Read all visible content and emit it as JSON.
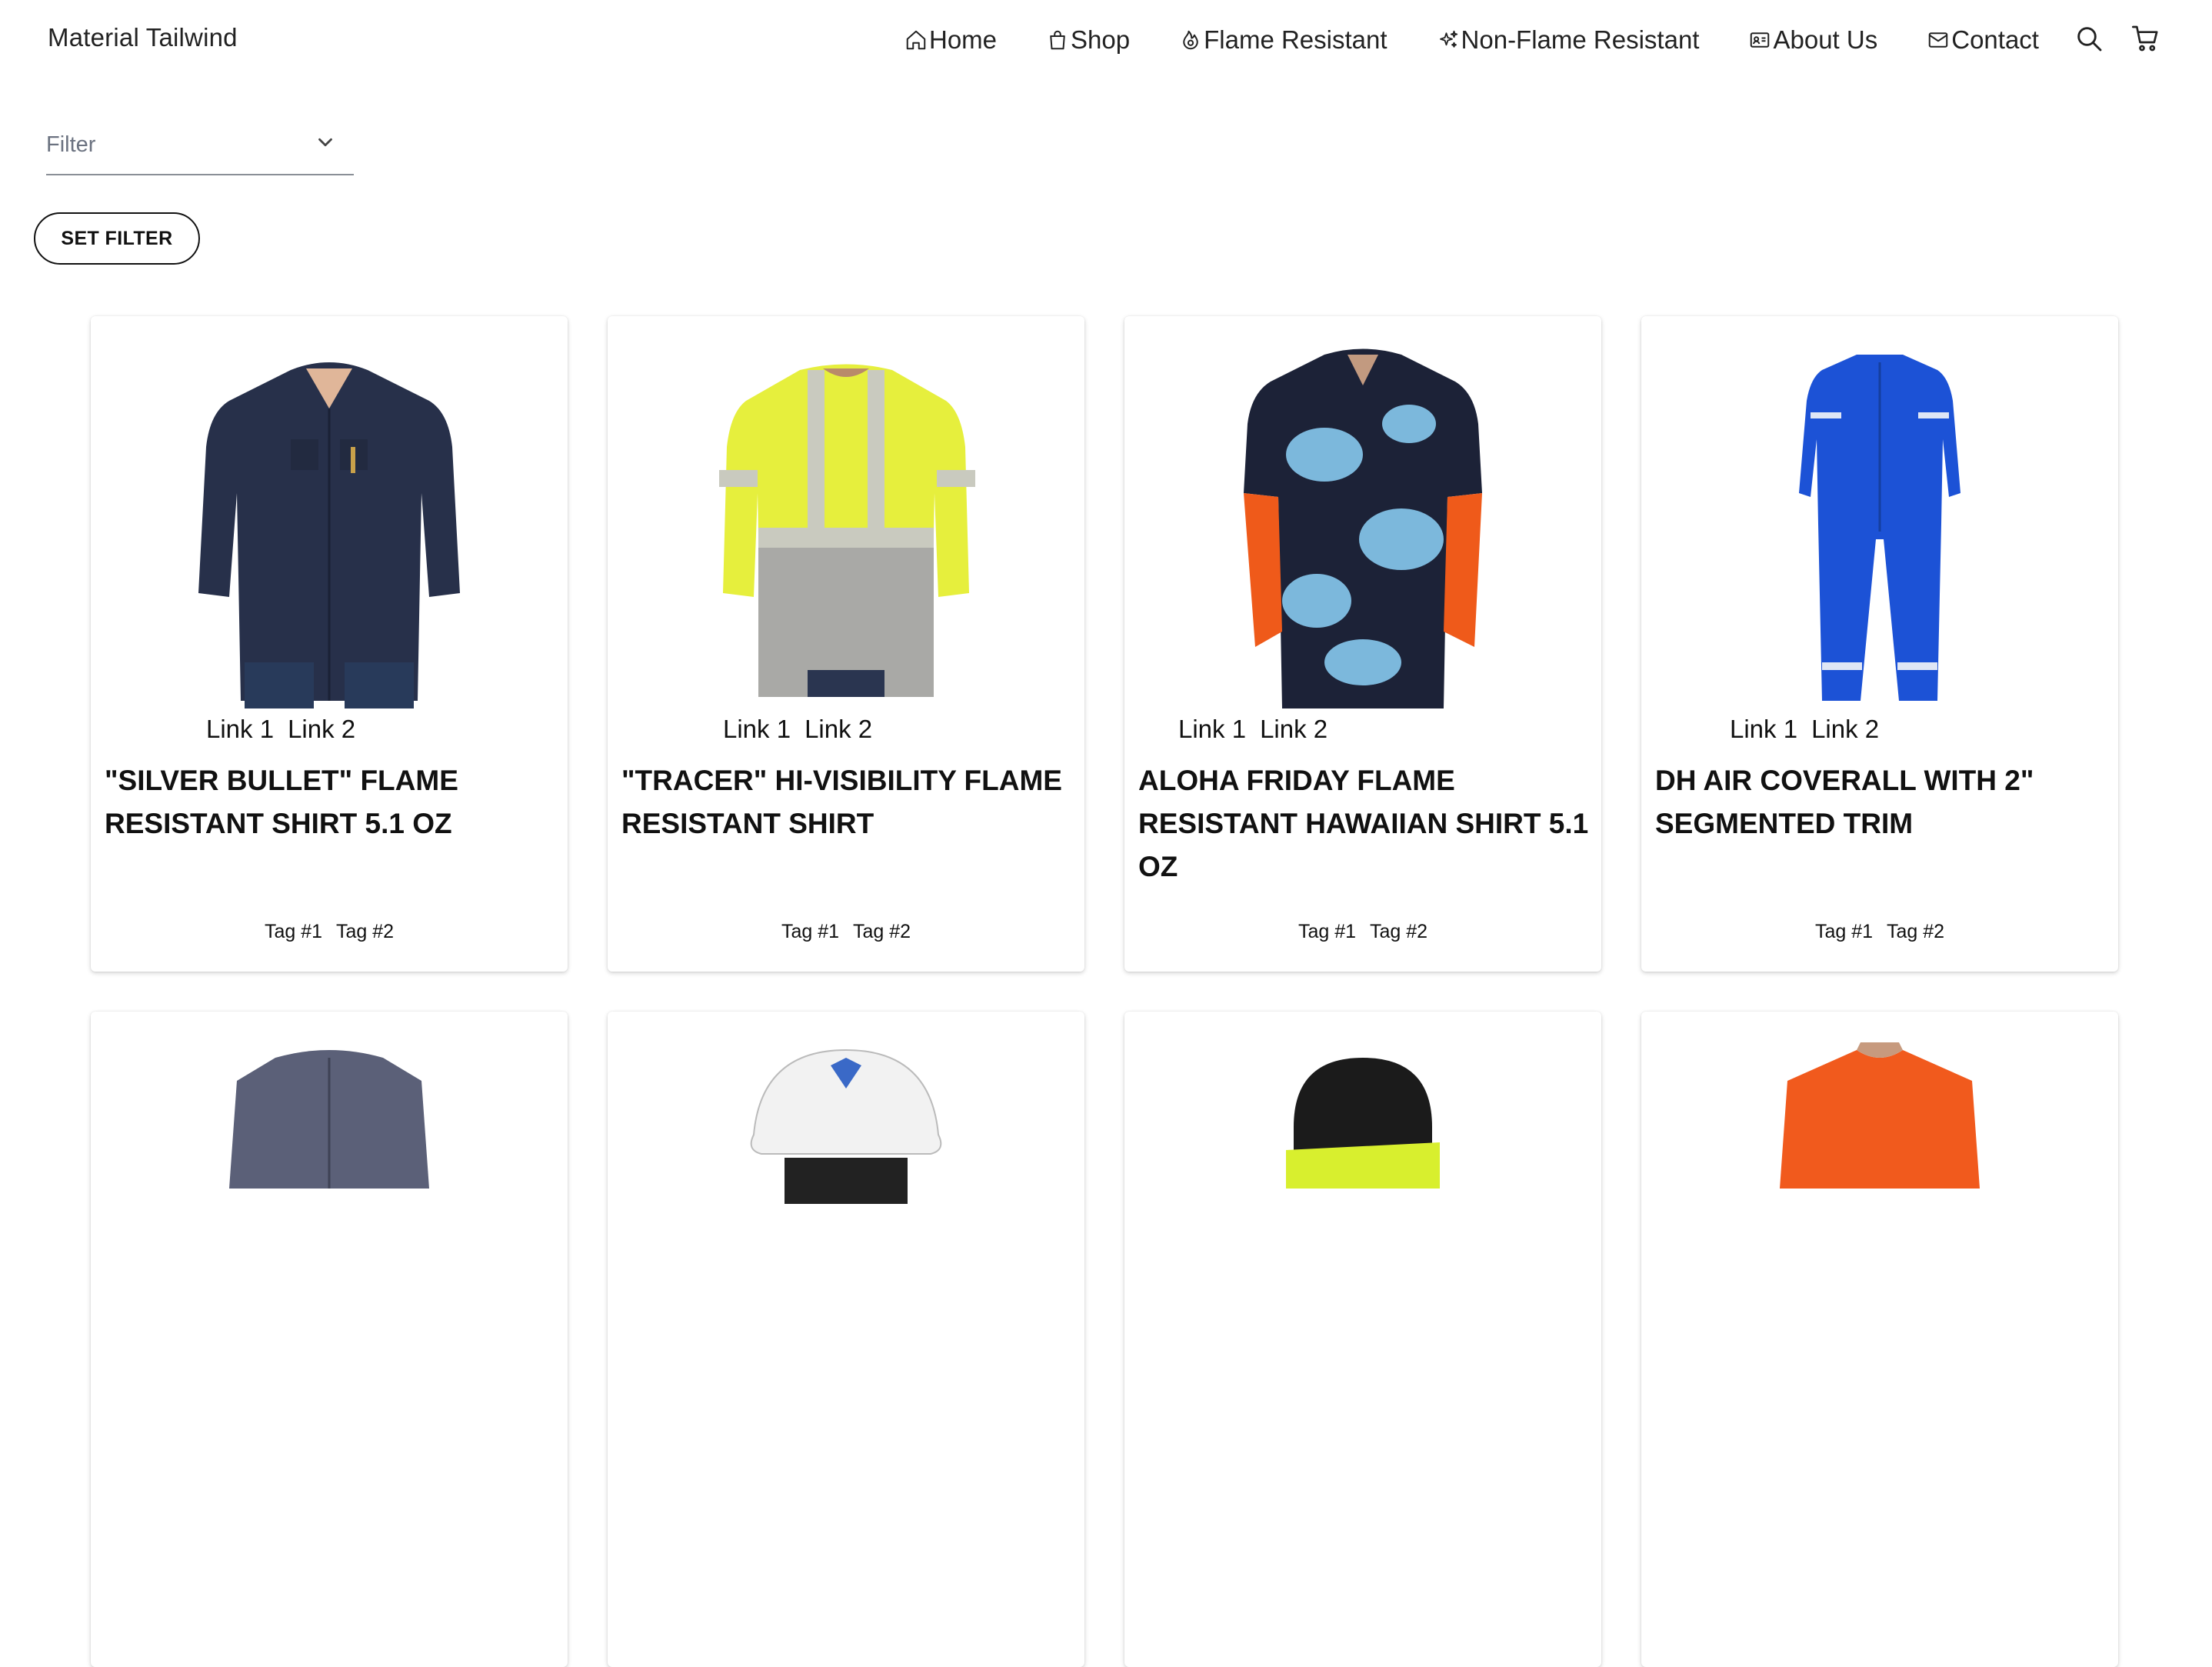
{
  "brand": "Material Tailwind",
  "nav": [
    {
      "label": "Home",
      "icon": "home-icon"
    },
    {
      "label": "Shop",
      "icon": "shopping-bag-icon"
    },
    {
      "label": "Flame Resistant",
      "icon": "fire-icon"
    },
    {
      "label": "Non-Flame Resistant",
      "icon": "sparkles-icon"
    },
    {
      "label": "About Us",
      "icon": "id-card-icon"
    },
    {
      "label": "Contact",
      "icon": "envelope-icon"
    }
  ],
  "tools": [
    {
      "icon": "search-icon"
    },
    {
      "icon": "cart-icon"
    }
  ],
  "filter": {
    "placeholder": "Filter",
    "button": "SET FILTER"
  },
  "products": [
    {
      "title": "\"Silver Bullet\" Flame Resistant Shirt 5.1 oz",
      "links": [
        "Link 1",
        "Link 2"
      ],
      "tags": [
        "Tag #1",
        "Tag #2"
      ],
      "image": "navy-long-sleeve-work-shirt",
      "colors": {
        "main": "#27304a"
      }
    },
    {
      "title": "\"Tracer\" Hi-Visibility Flame Resistant Shirt",
      "links": [
        "Link 1",
        "Link 2"
      ],
      "tags": [
        "Tag #1",
        "Tag #2"
      ],
      "image": "hi-vis-yellow-gray-shirt",
      "colors": {
        "main": "#e6ef3d"
      }
    },
    {
      "title": "Aloha Friday Flame Resistant Hawaiian Shirt 5.1 oz",
      "links": [
        "Link 1",
        "Link 2"
      ],
      "tags": [
        "Tag #1",
        "Tag #2"
      ],
      "image": "floral-navy-hawaiian-shirt",
      "colors": {
        "main": "#1c2237"
      }
    },
    {
      "title": "DH Air Coverall with 2\" Segmented Trim",
      "links": [
        "Link 1",
        "Link 2"
      ],
      "tags": [
        "Tag #1",
        "Tag #2"
      ],
      "image": "royal-blue-coverall",
      "colors": {
        "main": "#1c52d6"
      }
    }
  ],
  "products_row2": [
    {
      "image": "gray-work-jacket"
    },
    {
      "image": "white-hard-hat"
    },
    {
      "image": "black-balaclava"
    },
    {
      "image": "orange-tshirt"
    }
  ]
}
